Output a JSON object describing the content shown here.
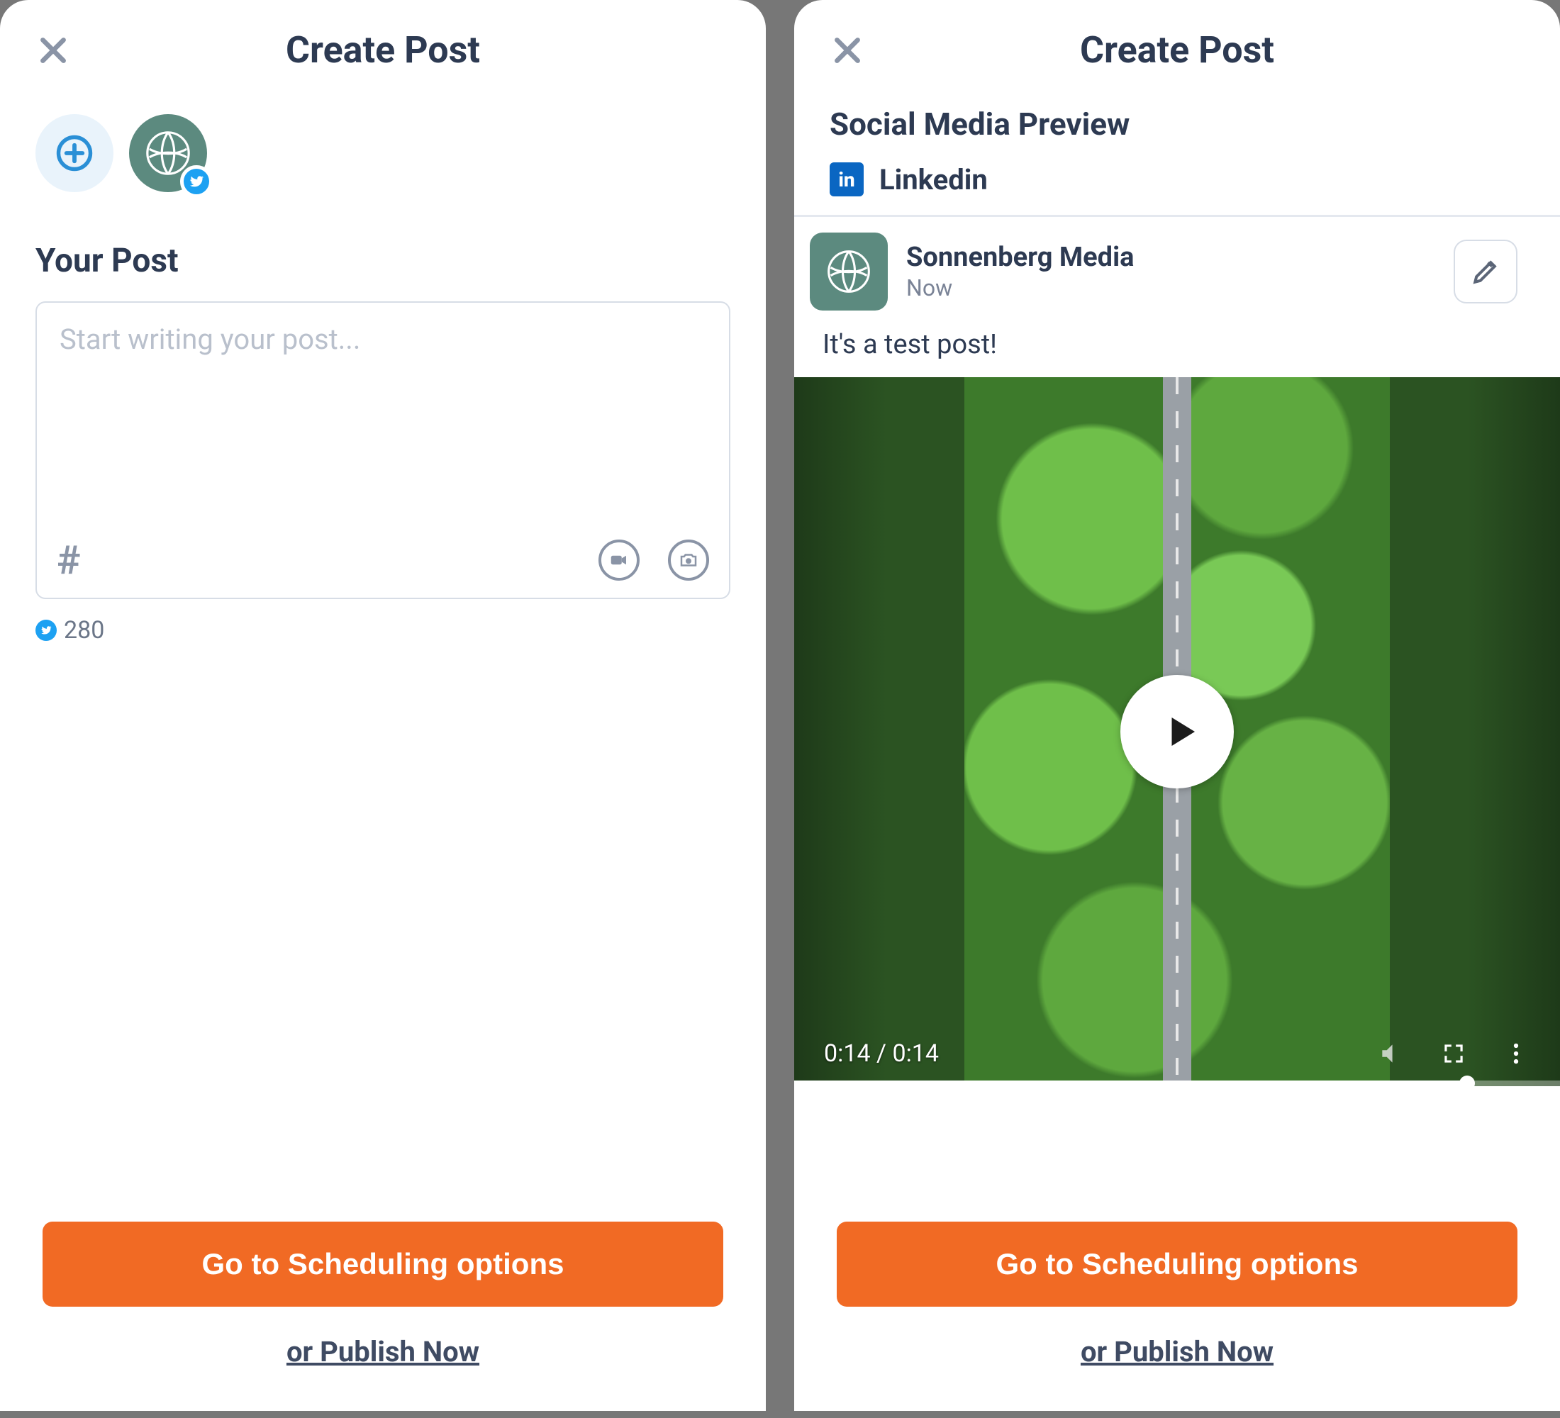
{
  "left": {
    "header": {
      "title": "Create Post"
    },
    "section_label": "Your Post",
    "composer": {
      "placeholder": "Start writing your post..."
    },
    "char_counter": {
      "count": "280"
    },
    "buttons": {
      "schedule": "Go to Scheduling options",
      "publish": "or Publish Now"
    }
  },
  "right": {
    "header": {
      "title": "Create Post"
    },
    "preview_title": "Social Media Preview",
    "platform": {
      "name": "Linkedin",
      "logo_text": "in"
    },
    "post": {
      "author": "Sonnenberg Media",
      "time": "Now",
      "text": "It's a test post!"
    },
    "video": {
      "time_label": "0:14 / 0:14"
    },
    "buttons": {
      "schedule": "Go to Scheduling options",
      "publish": "or Publish Now"
    }
  }
}
